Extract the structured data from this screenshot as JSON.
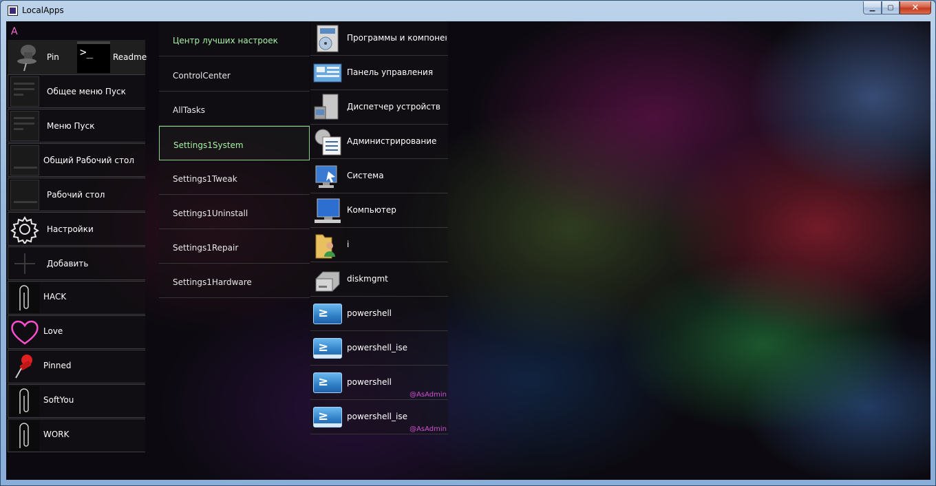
{
  "window": {
    "title": "LocalApps",
    "min_label": "▁",
    "max_label": "▢",
    "close_label": "✕"
  },
  "col_a": {
    "letter": "A",
    "pin_label": "Pin",
    "cmd_glyph": ">_",
    "readme_label": "Readme",
    "items": [
      {
        "label": "Общее меню Пуск",
        "icon": "start-menu-icon"
      },
      {
        "label": "Меню Пуск",
        "icon": "start-menu-icon"
      },
      {
        "label": "Общий Рабочий стол",
        "icon": "desktop-icon"
      },
      {
        "label": "Рабочий стол",
        "icon": "desktop-icon"
      },
      {
        "label": "Настройки",
        "icon": "gear-icon"
      },
      {
        "label": "Добавить",
        "icon": "plus-icon"
      },
      {
        "label": "HACK",
        "icon": "paperclip-icon"
      },
      {
        "label": "Love",
        "icon": "heart-icon"
      },
      {
        "label": "Pinned",
        "icon": "pushpin-icon"
      },
      {
        "label": "SoftYou",
        "icon": "paperclip-icon"
      },
      {
        "label": "WORK",
        "icon": "paperclip-icon"
      }
    ]
  },
  "col_b": {
    "items": [
      "Центр лучших настроек",
      "ControlCenter",
      "AllTasks",
      "Settings1System",
      "Settings1Tweak",
      "Settings1Uninstall",
      "Settings1Repair",
      "Settings1Hardware"
    ],
    "selected": "Settings1System"
  },
  "col_c": {
    "items": [
      {
        "label": "Программы и компоненты",
        "icon": "programs-icon"
      },
      {
        "label": "Панель управления",
        "icon": "control-panel-icon"
      },
      {
        "label": "Диспетчер устройств",
        "icon": "device-manager-icon"
      },
      {
        "label": "Администрирование",
        "icon": "admin-tools-icon"
      },
      {
        "label": "Система",
        "icon": "system-icon"
      },
      {
        "label": "Компьютер",
        "icon": "computer-icon"
      },
      {
        "label": "i",
        "icon": "user-folder-icon"
      },
      {
        "label": "diskmgmt",
        "icon": "disk-icon"
      },
      {
        "label": "powershell",
        "icon": "powershell-icon"
      },
      {
        "label": "powershell_ise",
        "icon": "powershell-ise-icon"
      },
      {
        "label": "powershell",
        "icon": "powershell-icon",
        "badge": "@AsAdmin"
      },
      {
        "label": "powershell_ise",
        "icon": "powershell-ise-icon",
        "badge": "@AsAdmin"
      }
    ]
  }
}
